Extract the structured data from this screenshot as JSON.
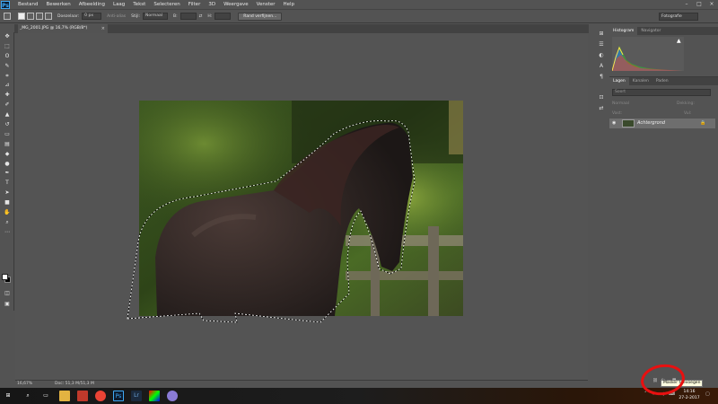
{
  "app": {
    "logo": "Ps"
  },
  "menu": [
    "Bestand",
    "Bewerken",
    "Afbeelding",
    "Laag",
    "Tekst",
    "Selecteren",
    "Filter",
    "3D",
    "Weergave",
    "Venster",
    "Help"
  ],
  "options": {
    "feather_label": "Doezelaar:",
    "feather_value": "0 px",
    "antialias_label": "Anti-alias",
    "style_label": "Stijl:",
    "style_value": "Normaal",
    "width_label": "B:",
    "height_label": "H:",
    "refine_button": "Rand verfijnen...",
    "workspace": "Fotografie"
  },
  "document": {
    "tab_title": "_MG_2001.JPG @ 16,7% (RGB/8*)",
    "close": "×",
    "zoom": "16,67%",
    "doc_size": "Doc: 51,3 M/51,3 M"
  },
  "panels": {
    "histogram_tabs": [
      "Histogram",
      "Navigator"
    ],
    "layers_tabs": [
      "Lagen",
      "Kanalen",
      "Paden"
    ],
    "layer_search": "Soort",
    "blend_mode": "Normaal",
    "opacity_label": "Dekking:",
    "lock_label": "Vast:",
    "fill_label": "Vul:",
    "layer_name": "Achtergrond",
    "footer_fx": "fx",
    "tooltip": "Masker toevoegen"
  },
  "taskbar": {
    "time": "14:16",
    "date": "27-2-2017"
  },
  "colors": {
    "accent": "#3fa9f5",
    "annotation": "#e81010"
  }
}
